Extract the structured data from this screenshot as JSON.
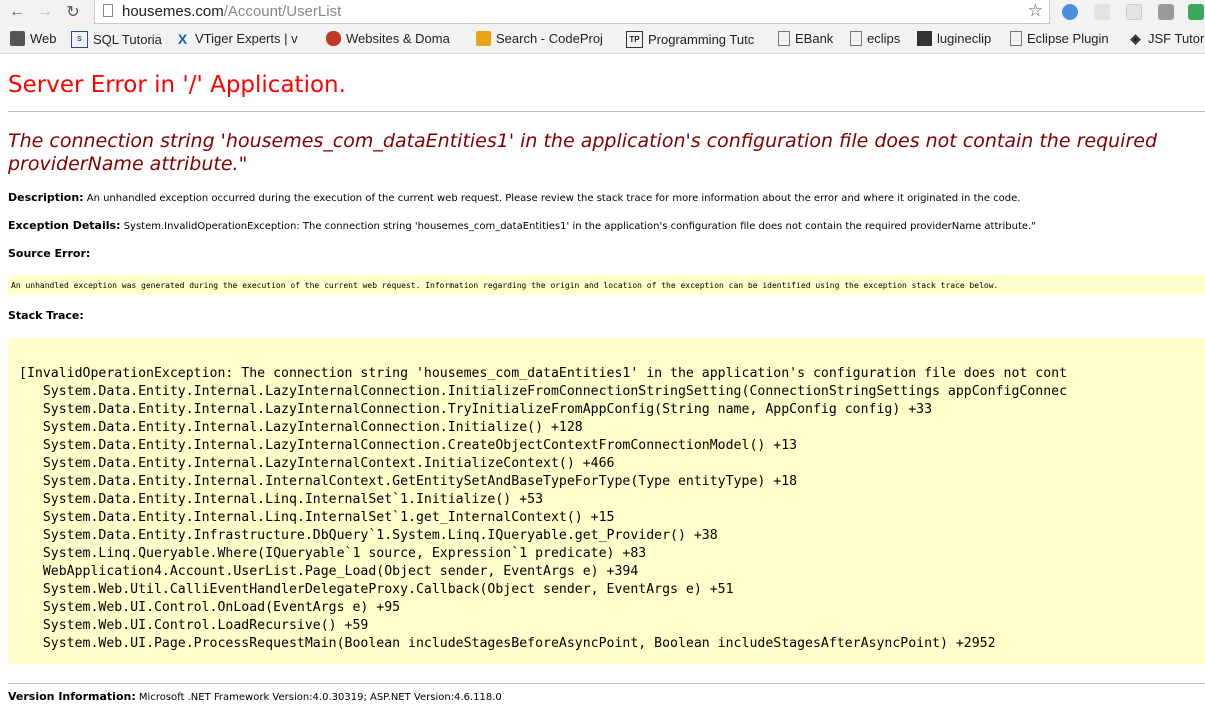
{
  "browser": {
    "url_host": "housemes.com",
    "url_path": "/Account/UserList",
    "bookmarks": [
      "Web",
      "SQL Tutoria",
      "VTiger Experts | v",
      "Websites & Doma",
      "Search - CodeProj",
      "Programming Tutc",
      "EBank",
      "eclips",
      "lugineclip",
      "Eclipse Plugin",
      "JSF Tutori"
    ]
  },
  "page": {
    "title": "Server Error in '/' Application.",
    "error_message": "The connection string 'housemes_com_dataEntities1' in the application's configuration file does not contain the required providerName attribute.\"",
    "description_label": "Description:",
    "description_text": "An unhandled exception occurred during the execution of the current web request. Please review the stack trace for more information about the error and where it originated in the code.",
    "exception_label": "Exception Details:",
    "exception_text": "System.InvalidOperationException: The connection string 'housemes_com_dataEntities1' in the application's configuration file does not contain the required providerName attribute.\"",
    "source_error_label": "Source Error:",
    "source_error_text": "An unhandled exception was generated during the execution of the current web request. Information regarding the origin and location of the exception can be identified using the exception stack trace below.",
    "stack_trace_label": "Stack Trace:",
    "stack_trace": "[InvalidOperationException: The connection string 'housemes_com_dataEntities1' in the application's configuration file does not cont\n   System.Data.Entity.Internal.LazyInternalConnection.InitializeFromConnectionStringSetting(ConnectionStringSettings appConfigConnec\n   System.Data.Entity.Internal.LazyInternalConnection.TryInitializeFromAppConfig(String name, AppConfig config) +33\n   System.Data.Entity.Internal.LazyInternalConnection.Initialize() +128\n   System.Data.Entity.Internal.LazyInternalConnection.CreateObjectContextFromConnectionModel() +13\n   System.Data.Entity.Internal.LazyInternalContext.InitializeContext() +466\n   System.Data.Entity.Internal.InternalContext.GetEntitySetAndBaseTypeForType(Type entityType) +18\n   System.Data.Entity.Internal.Linq.InternalSet`1.Initialize() +53\n   System.Data.Entity.Internal.Linq.InternalSet`1.get_InternalContext() +15\n   System.Data.Entity.Infrastructure.DbQuery`1.System.Linq.IQueryable.get_Provider() +38\n   System.Linq.Queryable.Where(IQueryable`1 source, Expression`1 predicate) +83\n   WebApplication4.Account.UserList.Page_Load(Object sender, EventArgs e) +394\n   System.Web.Util.CalliEventHandlerDelegateProxy.Callback(Object sender, EventArgs e) +51\n   System.Web.UI.Control.OnLoad(EventArgs e) +95\n   System.Web.UI.Control.LoadRecursive() +59\n   System.Web.UI.Page.ProcessRequestMain(Boolean includeStagesBeforeAsyncPoint, Boolean includeStagesAfterAsyncPoint) +2952",
    "version_label": "Version Information:",
    "version_text": "Microsoft .NET Framework Version:4.0.30319; ASP.NET Version:4.6.118.0"
  }
}
